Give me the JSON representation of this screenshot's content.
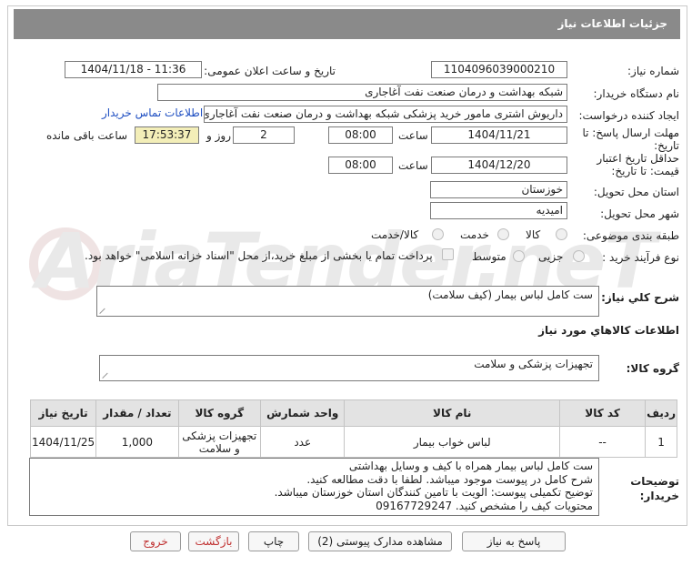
{
  "header": {
    "title": "جزئیات اطلاعات نیاز"
  },
  "watermark": {
    "text": "AriaTender.neT"
  },
  "fields": {
    "need_number_label": "شماره نیاز:",
    "need_number": "1104096039000210",
    "announce_label": "تاریخ و ساعت اعلان عمومی:",
    "announce_value": "1404/11/18 - 11:36",
    "buyer_org_label": "نام دستگاه خریدار:",
    "buyer_org": "شبکه بهداشت و درمان صنعت نفت آغاجاری",
    "creator_label": "ایجاد کننده درخواست:",
    "creator": "داریوش اشتری مامور خرید پزشکی شبکه بهداشت و درمان صنعت نفت آغاجاری",
    "contact_link": "اطلاعات تماس خریدار",
    "deadline_label_1": "مهلت ارسال پاسخ: تا",
    "deadline_label_2": "تاریخ:",
    "deadline_date": "1404/11/21",
    "time_label": "ساعت",
    "deadline_time": "08:00",
    "days_value": "2",
    "days_label": "روز و",
    "remaining_time": "17:53:37",
    "remaining_label": "ساعت باقی مانده",
    "validity_label_1": "حداقل تاریخ اعتبار",
    "validity_label_2": "قیمت: تا تاریخ:",
    "validity_date": "1404/12/20",
    "validity_time": "08:00",
    "province_label": "استان محل تحویل:",
    "province": "خوزستان",
    "city_label": "شهر محل تحویل:",
    "city": "امیدیه",
    "category_label": "طبقه بندی موضوعی:",
    "cat_goods": "کالا",
    "cat_service": "خدمت",
    "cat_goods_service": "کالا/خدمت",
    "process_label": "نوع فرآیند خرید :",
    "proc_minor": "جزیی",
    "proc_medium": "متوسط",
    "payment_note": "پرداخت تمام یا بخشی از مبلغ خرید،از محل \"اسناد خزانه اسلامی\" خواهد بود."
  },
  "description": {
    "label": "شرح کلي نياز:",
    "value": "ست کامل لباس بیمار (کیف سلامت)"
  },
  "goods_section": {
    "title": "اطلاعات کالاهاي مورد نياز",
    "group_label": "گروه کالا:",
    "group_value": "تجهیزات پزشکی و سلامت"
  },
  "table": {
    "headers": [
      "ردیف",
      "کد کالا",
      "نام کالا",
      "واحد شمارش",
      "گروه کالا",
      "تعداد / مقدار",
      "تاریخ نیاز"
    ],
    "rows": [
      [
        "1",
        "--",
        "لباس خواب بیمار",
        "عدد",
        "تجهیزات پزشکی و سلامت",
        "1,000",
        "1404/11/25"
      ]
    ]
  },
  "buyer_notes": {
    "label_1": "توضیحات",
    "label_2": "خریدار:",
    "lines": [
      "ست کامل لباس بیمار همراه با کیف و وسایل بهداشتی",
      "شرح کامل در پیوست موجود میباشد. لطفا با دقت مطالعه کنید.",
      "توضیح تکمیلی پیوست: الویت با تامین کنندگان استان خوزستان میباشد.",
      "محتویات کیف را مشخص کنید. 09167729247"
    ]
  },
  "buttons": {
    "respond": "پاسخ به نیاز",
    "attachments": "مشاهده مدارک پیوستی (2)",
    "print": "چاپ",
    "back": "بازگشت",
    "exit": "خروج"
  },
  "colors": {
    "header_bg": "#8a8a8a",
    "time_bg": "#f3eeb8",
    "link": "#1f4fc2"
  }
}
